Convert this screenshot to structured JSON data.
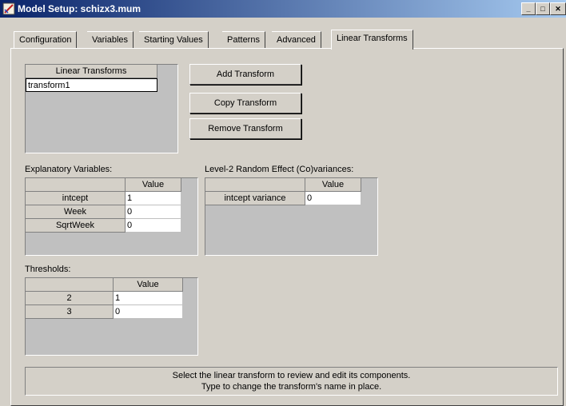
{
  "window": {
    "title": "Model Setup: schizx3.mum",
    "icon": "model-setup-icon"
  },
  "tabs": [
    {
      "label": "Configuration"
    },
    {
      "label": "Variables"
    },
    {
      "label": "Starting Values"
    },
    {
      "label": "Patterns"
    },
    {
      "label": "Advanced"
    },
    {
      "label": "Linear Transforms",
      "active": true
    }
  ],
  "transforms": {
    "header": "Linear Transforms",
    "items": [
      "transform1"
    ]
  },
  "buttons": {
    "add": "Add Transform",
    "copy": "Copy Transform",
    "remove": "Remove Transform"
  },
  "explanatory": {
    "label": "Explanatory Variables:",
    "value_header": "Value",
    "rows": [
      {
        "name": "intcept",
        "value": "1"
      },
      {
        "name": "Week",
        "value": "0"
      },
      {
        "name": "SqrtWeek",
        "value": "0"
      }
    ]
  },
  "random_effects": {
    "label": "Level-2 Random Effect (Co)variances:",
    "value_header": "Value",
    "rows": [
      {
        "name": "intcept variance",
        "value": "0"
      }
    ]
  },
  "thresholds": {
    "label": "Thresholds:",
    "value_header": "Value",
    "rows": [
      {
        "name": "2",
        "value": "1"
      },
      {
        "name": "3",
        "value": "0"
      }
    ]
  },
  "status": {
    "line1": "Select the linear transform to review and edit its components.",
    "line2": "Type to change the transform's name in place."
  }
}
